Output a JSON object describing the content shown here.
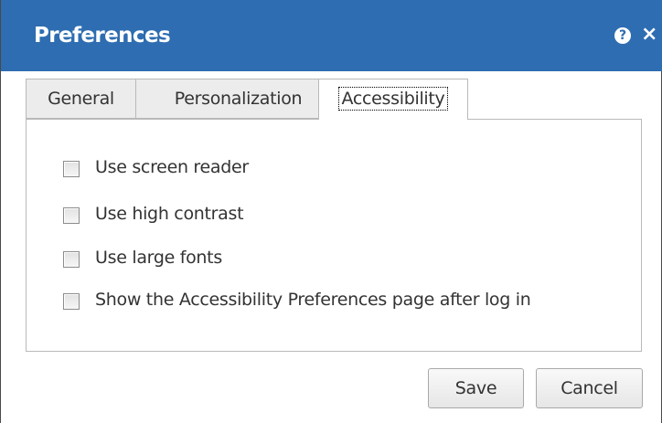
{
  "dialog": {
    "title": "Preferences",
    "help_symbol": "?",
    "close_symbol": "×",
    "help_icon": "help-circle-icon",
    "close_icon": "close-icon"
  },
  "tabs": [
    {
      "label": "General",
      "active": false
    },
    {
      "label": "Personalization",
      "active": false
    },
    {
      "label": "Accessibility",
      "active": true
    }
  ],
  "options": [
    {
      "label": "Use screen reader",
      "checked": false
    },
    {
      "label": "Use high contrast",
      "checked": false
    },
    {
      "label": "Use large fonts",
      "checked": false
    },
    {
      "label": "Show the Accessibility Preferences page after log in",
      "checked": false
    }
  ],
  "buttons": {
    "save_label": "Save",
    "cancel_label": "Cancel"
  },
  "colors": {
    "titlebar": "#2e6db1",
    "title_text": "#ffffff",
    "tab_inactive_bg": "#ececec",
    "border": "#b9b9b9"
  }
}
